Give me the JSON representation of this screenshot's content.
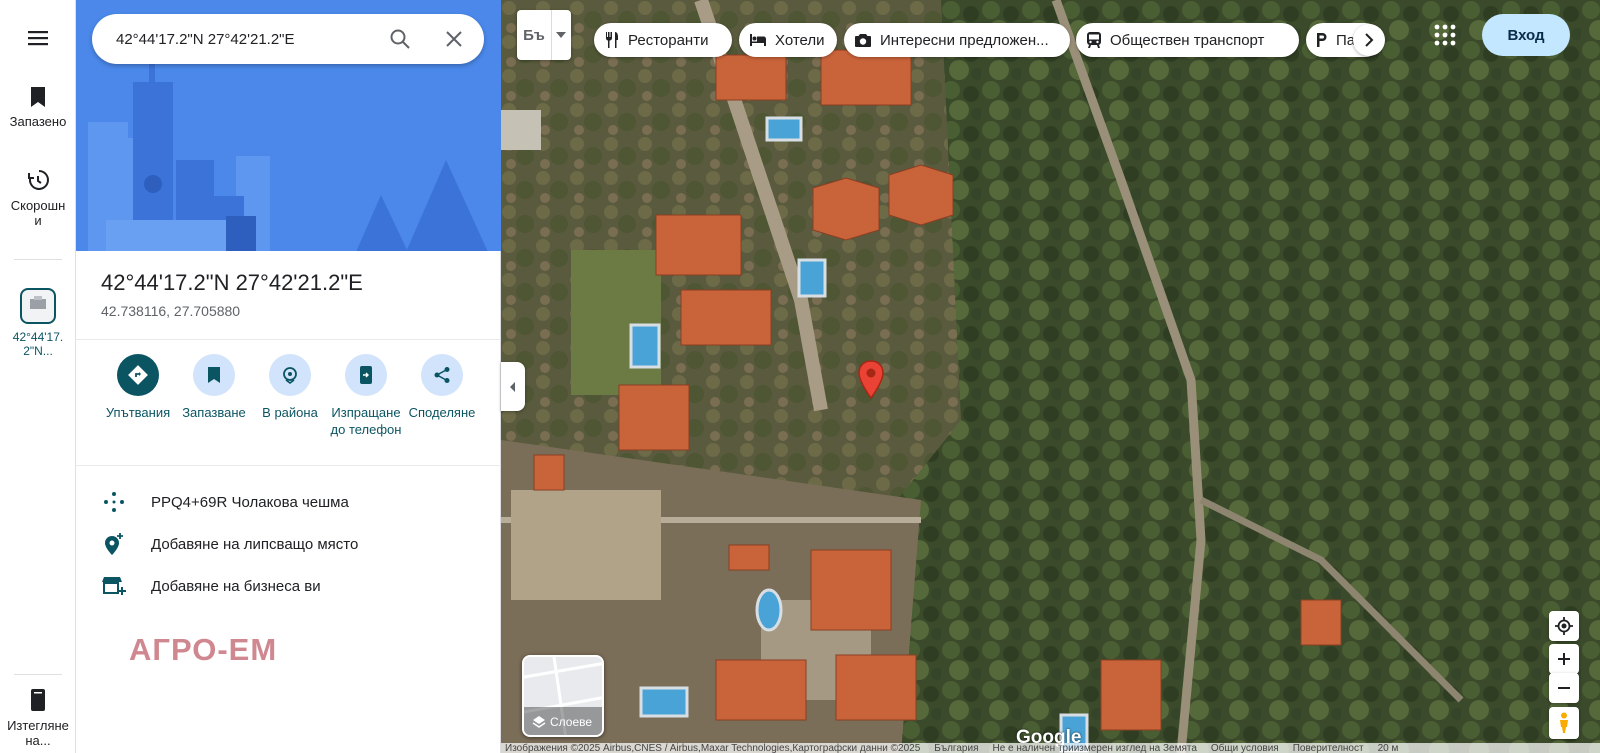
{
  "rail": {
    "saved_label": "Запазено",
    "recent_label": "Скорошни",
    "recent_place_label": "42°44'17.2\"N...",
    "download_label": "Изтегляне на..."
  },
  "search": {
    "value": "42°44'17.2\"N 27°42'21.2\"E"
  },
  "place": {
    "title": "42°44'17.2\"N 27°42'21.2\"E",
    "decimal": "42.738116, 27.705880"
  },
  "actions": [
    {
      "label": "Упътвания",
      "icon": "directions-icon"
    },
    {
      "label": "Запазване",
      "icon": "bookmark-icon"
    },
    {
      "label": "В района",
      "icon": "nearby-icon"
    },
    {
      "label": "Изпращане до телефон",
      "icon": "send-to-phone-icon"
    },
    {
      "label": "Споделяне",
      "icon": "share-icon"
    }
  ],
  "info": {
    "plus_code": "PPQ4+69R Чолакова чешма",
    "add_missing": "Добавяне на липсващо място",
    "add_business": "Добавяне на бизнеса ви"
  },
  "watermark": "АГРО-ЕМ",
  "map": {
    "lang_button": "Бъ",
    "chips": [
      {
        "label": "Ресторанти",
        "icon": "restaurant-icon"
      },
      {
        "label": "Хотели",
        "icon": "hotel-icon"
      },
      {
        "label": "Интересни предложен...",
        "icon": "camera-icon"
      },
      {
        "label": "Обществен транспорт",
        "icon": "transit-icon"
      },
      {
        "label": "Па",
        "icon": "parking-icon"
      }
    ],
    "signin": "Вход",
    "layers_label": "Слоеве",
    "google": "Google",
    "footer": {
      "attribution": "Изображения ©2025 Airbus,CNES / Airbus,Maxar Technologies,Картографски данни ©2025",
      "country": "България",
      "terrain_note": "Не е наличен триизмерен изглед на Земята",
      "terms": "Общи условия",
      "privacy": "Поверителност",
      "scale": "20 м"
    }
  },
  "colors": {
    "accent": "#0b5563",
    "hero_blue": "#4a86e8",
    "action_circle": "#d2e3fc",
    "signin_bg": "#c2e7ff",
    "pin_red": "#ea4335",
    "watermark": "#d08890"
  }
}
